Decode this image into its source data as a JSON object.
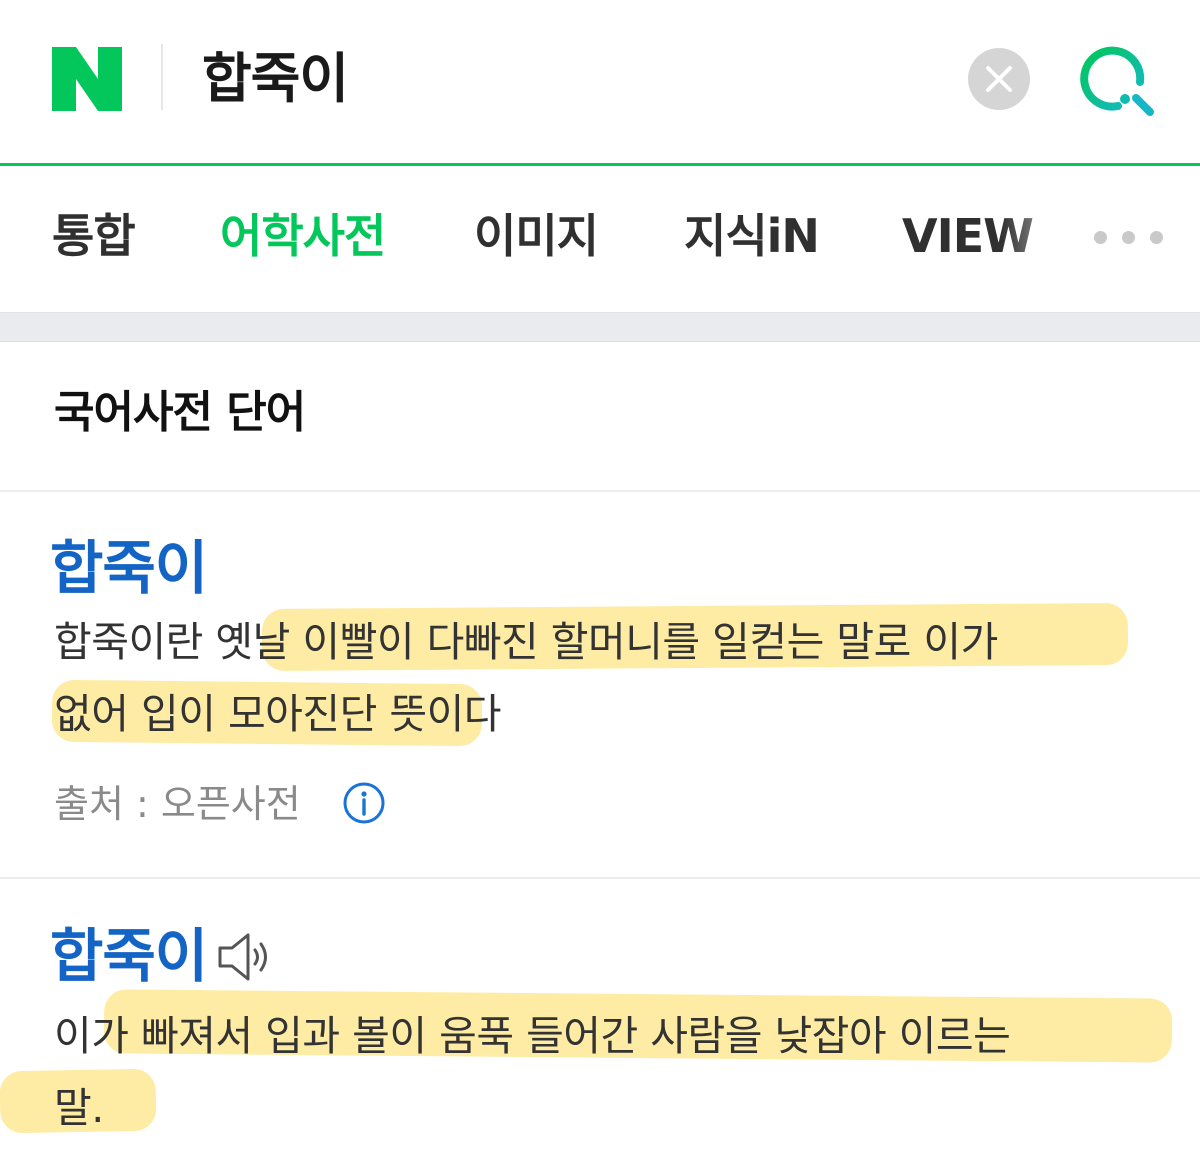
{
  "search": {
    "logo_letter": "N",
    "query": "합죽이"
  },
  "tabs": [
    {
      "label": "통합",
      "active": false
    },
    {
      "label": "어학사전",
      "active": true
    },
    {
      "label": "이미지",
      "active": false
    },
    {
      "label": "지식iN",
      "active": false
    },
    {
      "label": "VIEW",
      "active": false
    }
  ],
  "section": {
    "title": "국어사전 단어"
  },
  "entries": [
    {
      "word": "합죽이",
      "definition_line1": "합죽이란 옛날 이빨이 다빠진 할머니를 일컫는 말로 이가",
      "definition_line2": "없어 입이 모아진단 뜻이다",
      "source": "출처 : 오픈사전"
    },
    {
      "word": "합죽이",
      "definition_line1": "이가 빠져서 입과 볼이 움푹 들어간 사람을 낮잡아 이르는",
      "definition_line2": "말."
    }
  ],
  "colors": {
    "brand_green": "#03c75a",
    "link_blue": "#1364c4",
    "highlighter": "#fddc5a",
    "gray_band": "#e9ebee"
  },
  "icons": [
    "naver-logo-icon",
    "clear-icon",
    "search-icon",
    "more-icon",
    "info-icon",
    "speaker-icon"
  ]
}
